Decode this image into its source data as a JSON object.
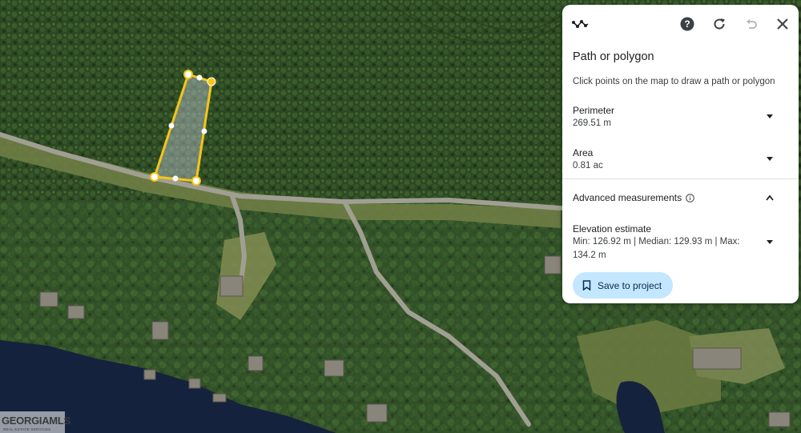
{
  "map": {
    "colors": {
      "forest": "#2f4a24",
      "water": "#15223d",
      "road": "#9a9a8c",
      "grass": "#7d8a52",
      "polygon_stroke": "#f5c518"
    }
  },
  "panel": {
    "toolbar": {
      "measure_icon": "path-measure-icon",
      "help_icon": "help-icon",
      "reset_icon": "reset-icon",
      "undo_icon": "undo-icon",
      "close_icon": "close-icon"
    },
    "title": "Path or polygon",
    "instruction": "Click points on the map to draw a path or polygon",
    "perimeter": {
      "label": "Perimeter",
      "value": "269.51 m"
    },
    "area": {
      "label": "Area",
      "value": "0.81 ac"
    },
    "advanced": {
      "label": "Advanced measurements",
      "info_icon": "info-icon"
    },
    "elevation": {
      "label": "Elevation estimate",
      "value": "Min: 126.92 m | Median: 129.93 m | Max: 134.2 m"
    },
    "save_button": {
      "label": "Save to project",
      "icon": "bookmark-icon",
      "accent": "#c2e7ff"
    }
  },
  "watermark": {
    "brand": "GEORGIAMLS",
    "sub": "REAL ESTATE SERVICES"
  }
}
